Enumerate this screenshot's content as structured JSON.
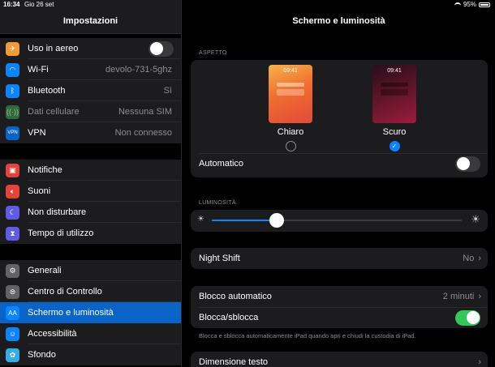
{
  "status": {
    "time": "16:34",
    "date": "Gio 26 set",
    "battery": "95%"
  },
  "sidebar": {
    "title": "Impostazioni",
    "groups": [
      [
        {
          "label": "Uso in aereo",
          "icon": "airplane-icon",
          "color": "#f09a37",
          "toggle": false
        },
        {
          "label": "Wi-Fi",
          "icon": "wifi-icon",
          "color": "#0a84ff",
          "value": "devolo-731-5ghz"
        },
        {
          "label": "Bluetooth",
          "icon": "bluetooth-icon",
          "color": "#0a84ff",
          "value": "Sì"
        },
        {
          "label": "Dati cellulare",
          "icon": "antenna-icon",
          "color": "#2f6b3a",
          "value": "Nessuna SIM"
        },
        {
          "label": "VPN",
          "icon": "vpn-icon",
          "color": "#0a63c7",
          "value": "Non connesso"
        }
      ],
      [
        {
          "label": "Notifiche",
          "icon": "notifications-icon",
          "color": "#e5423a"
        },
        {
          "label": "Suoni",
          "icon": "speaker-icon",
          "color": "#e5423a"
        },
        {
          "label": "Non disturbare",
          "icon": "moon-icon",
          "color": "#5e5ce6"
        },
        {
          "label": "Tempo di utilizzo",
          "icon": "hourglass-icon",
          "color": "#5e5ce6"
        }
      ],
      [
        {
          "label": "Generali",
          "icon": "gear-icon",
          "color": "#636366"
        },
        {
          "label": "Centro di Controllo",
          "icon": "switches-icon",
          "color": "#636366"
        },
        {
          "label": "Schermo e luminosità",
          "icon": "text-size-icon",
          "color": "#0a84ff",
          "active": true
        },
        {
          "label": "Accessibilità",
          "icon": "accessibility-icon",
          "color": "#0a84ff"
        },
        {
          "label": "Sfondo",
          "icon": "wallpaper-icon",
          "color": "#32ade6"
        }
      ]
    ]
  },
  "main": {
    "title": "Schermo e luminosità",
    "appearance_label": "ASPETTO",
    "light": {
      "time": "09:41",
      "label": "Chiaro",
      "selected": false
    },
    "dark": {
      "time": "09:41",
      "label": "Scuro",
      "selected": true
    },
    "automatic_label": "Automatico",
    "automatic_on": false,
    "brightness_label": "LUMINOSITÀ",
    "brightness_level": 0.26,
    "night_shift": {
      "label": "Night Shift",
      "value": "No"
    },
    "auto_lock": {
      "label": "Blocco automatico",
      "value": "2 minuti"
    },
    "lock_unlock": {
      "label": "Blocca/sblocca",
      "on": true
    },
    "lock_note": "Blocca e sblocca automaticamente iPad quando apri e chiudi la custodia di iPad.",
    "text_size": {
      "label": "Dimensione testo"
    }
  }
}
